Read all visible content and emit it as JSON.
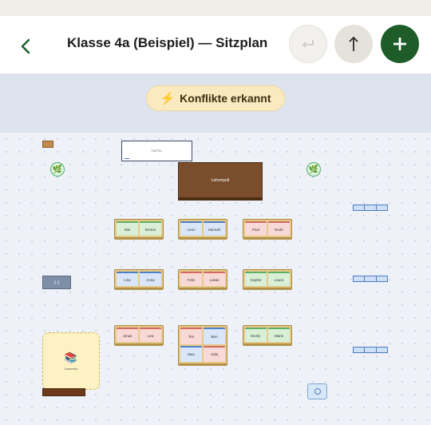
{
  "header": {
    "title": "Klasse 4a (Beispiel) — Sitzplan",
    "back_icon": "chevron-left-icon",
    "undo_icon": "undo-icon",
    "export_icon": "arrow-up-icon",
    "add_icon": "plus-icon"
  },
  "banner": {
    "conflict_label": "Konflikte erkannt",
    "conflict_icon": "lightning-icon"
  },
  "room": {
    "board_label": "TAFEL",
    "teacher_desk_label": "Lehrerpult",
    "reading_corner_label": "Leseecke",
    "cabinet_label": "▯ ▯"
  },
  "desks": [
    {
      "seats": [
        {
          "name": "Mia",
          "color": "green"
        },
        {
          "name": "Emma",
          "color": "green"
        }
      ]
    },
    {
      "seats": [
        {
          "name": "Leon",
          "color": "blue"
        },
        {
          "name": "Hannah",
          "color": "blue"
        }
      ]
    },
    {
      "seats": [
        {
          "name": "Paul",
          "color": "red"
        },
        {
          "name": "Noah",
          "color": "red"
        }
      ]
    },
    {
      "seats": [
        {
          "name": "Lina",
          "color": "blue"
        },
        {
          "name": "Anna",
          "color": "blue"
        }
      ]
    },
    {
      "seats": [
        {
          "name": "Felix",
          "color": "red"
        },
        {
          "name": "Lukas",
          "color": "red"
        }
      ]
    },
    {
      "seats": [
        {
          "name": "Sophie",
          "color": "green"
        },
        {
          "name": "Laura",
          "color": "green"
        }
      ]
    },
    {
      "seats": [
        {
          "name": "Jonas",
          "color": "red"
        },
        {
          "name": "Lea",
          "color": "red"
        }
      ]
    },
    {
      "seats": [
        {
          "name": "Tim",
          "color": "red"
        },
        {
          "name": "Ben",
          "color": "blue"
        },
        {
          "name": "Max",
          "color": "blue"
        },
        {
          "name": "Julia",
          "color": "red"
        }
      ]
    },
    {
      "seats": [
        {
          "name": "Moritz",
          "color": "green"
        },
        {
          "name": "Marie",
          "color": "green"
        }
      ]
    }
  ],
  "colors": {
    "accent": "#1e5c2a",
    "seat_green": "#d9f0d6",
    "seat_blue": "#d9e6f7",
    "seat_red": "#f9d9d6",
    "teacher_desk": "#7a4e2c"
  }
}
